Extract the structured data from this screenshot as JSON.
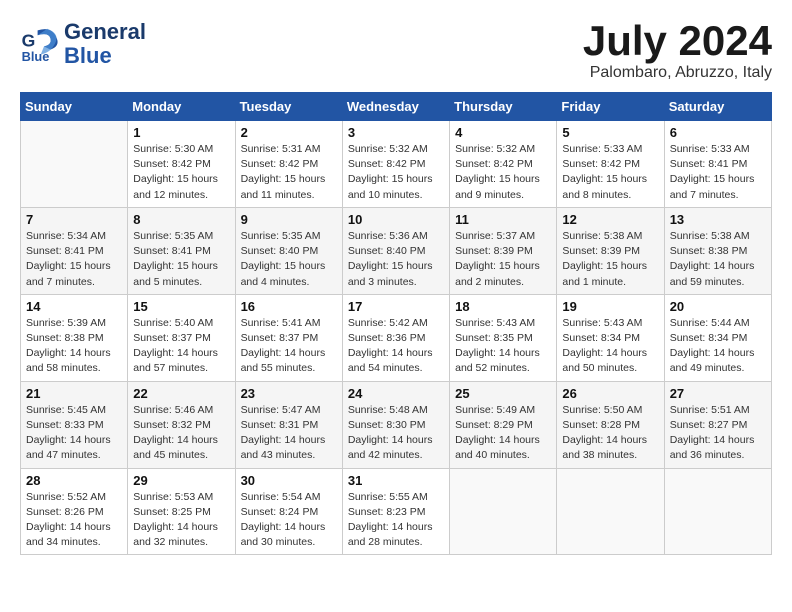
{
  "header": {
    "logo_line1": "General",
    "logo_line2": "Blue",
    "month_year": "July 2024",
    "location": "Palombaro, Abruzzo, Italy"
  },
  "weekdays": [
    "Sunday",
    "Monday",
    "Tuesday",
    "Wednesday",
    "Thursday",
    "Friday",
    "Saturday"
  ],
  "weeks": [
    [
      {
        "day": "",
        "info": ""
      },
      {
        "day": "1",
        "info": "Sunrise: 5:30 AM\nSunset: 8:42 PM\nDaylight: 15 hours\nand 12 minutes."
      },
      {
        "day": "2",
        "info": "Sunrise: 5:31 AM\nSunset: 8:42 PM\nDaylight: 15 hours\nand 11 minutes."
      },
      {
        "day": "3",
        "info": "Sunrise: 5:32 AM\nSunset: 8:42 PM\nDaylight: 15 hours\nand 10 minutes."
      },
      {
        "day": "4",
        "info": "Sunrise: 5:32 AM\nSunset: 8:42 PM\nDaylight: 15 hours\nand 9 minutes."
      },
      {
        "day": "5",
        "info": "Sunrise: 5:33 AM\nSunset: 8:42 PM\nDaylight: 15 hours\nand 8 minutes."
      },
      {
        "day": "6",
        "info": "Sunrise: 5:33 AM\nSunset: 8:41 PM\nDaylight: 15 hours\nand 7 minutes."
      }
    ],
    [
      {
        "day": "7",
        "info": "Sunrise: 5:34 AM\nSunset: 8:41 PM\nDaylight: 15 hours\nand 7 minutes."
      },
      {
        "day": "8",
        "info": "Sunrise: 5:35 AM\nSunset: 8:41 PM\nDaylight: 15 hours\nand 5 minutes."
      },
      {
        "day": "9",
        "info": "Sunrise: 5:35 AM\nSunset: 8:40 PM\nDaylight: 15 hours\nand 4 minutes."
      },
      {
        "day": "10",
        "info": "Sunrise: 5:36 AM\nSunset: 8:40 PM\nDaylight: 15 hours\nand 3 minutes."
      },
      {
        "day": "11",
        "info": "Sunrise: 5:37 AM\nSunset: 8:39 PM\nDaylight: 15 hours\nand 2 minutes."
      },
      {
        "day": "12",
        "info": "Sunrise: 5:38 AM\nSunset: 8:39 PM\nDaylight: 15 hours\nand 1 minute."
      },
      {
        "day": "13",
        "info": "Sunrise: 5:38 AM\nSunset: 8:38 PM\nDaylight: 14 hours\nand 59 minutes."
      }
    ],
    [
      {
        "day": "14",
        "info": "Sunrise: 5:39 AM\nSunset: 8:38 PM\nDaylight: 14 hours\nand 58 minutes."
      },
      {
        "day": "15",
        "info": "Sunrise: 5:40 AM\nSunset: 8:37 PM\nDaylight: 14 hours\nand 57 minutes."
      },
      {
        "day": "16",
        "info": "Sunrise: 5:41 AM\nSunset: 8:37 PM\nDaylight: 14 hours\nand 55 minutes."
      },
      {
        "day": "17",
        "info": "Sunrise: 5:42 AM\nSunset: 8:36 PM\nDaylight: 14 hours\nand 54 minutes."
      },
      {
        "day": "18",
        "info": "Sunrise: 5:43 AM\nSunset: 8:35 PM\nDaylight: 14 hours\nand 52 minutes."
      },
      {
        "day": "19",
        "info": "Sunrise: 5:43 AM\nSunset: 8:34 PM\nDaylight: 14 hours\nand 50 minutes."
      },
      {
        "day": "20",
        "info": "Sunrise: 5:44 AM\nSunset: 8:34 PM\nDaylight: 14 hours\nand 49 minutes."
      }
    ],
    [
      {
        "day": "21",
        "info": "Sunrise: 5:45 AM\nSunset: 8:33 PM\nDaylight: 14 hours\nand 47 minutes."
      },
      {
        "day": "22",
        "info": "Sunrise: 5:46 AM\nSunset: 8:32 PM\nDaylight: 14 hours\nand 45 minutes."
      },
      {
        "day": "23",
        "info": "Sunrise: 5:47 AM\nSunset: 8:31 PM\nDaylight: 14 hours\nand 43 minutes."
      },
      {
        "day": "24",
        "info": "Sunrise: 5:48 AM\nSunset: 8:30 PM\nDaylight: 14 hours\nand 42 minutes."
      },
      {
        "day": "25",
        "info": "Sunrise: 5:49 AM\nSunset: 8:29 PM\nDaylight: 14 hours\nand 40 minutes."
      },
      {
        "day": "26",
        "info": "Sunrise: 5:50 AM\nSunset: 8:28 PM\nDaylight: 14 hours\nand 38 minutes."
      },
      {
        "day": "27",
        "info": "Sunrise: 5:51 AM\nSunset: 8:27 PM\nDaylight: 14 hours\nand 36 minutes."
      }
    ],
    [
      {
        "day": "28",
        "info": "Sunrise: 5:52 AM\nSunset: 8:26 PM\nDaylight: 14 hours\nand 34 minutes."
      },
      {
        "day": "29",
        "info": "Sunrise: 5:53 AM\nSunset: 8:25 PM\nDaylight: 14 hours\nand 32 minutes."
      },
      {
        "day": "30",
        "info": "Sunrise: 5:54 AM\nSunset: 8:24 PM\nDaylight: 14 hours\nand 30 minutes."
      },
      {
        "day": "31",
        "info": "Sunrise: 5:55 AM\nSunset: 8:23 PM\nDaylight: 14 hours\nand 28 minutes."
      },
      {
        "day": "",
        "info": ""
      },
      {
        "day": "",
        "info": ""
      },
      {
        "day": "",
        "info": ""
      }
    ]
  ]
}
